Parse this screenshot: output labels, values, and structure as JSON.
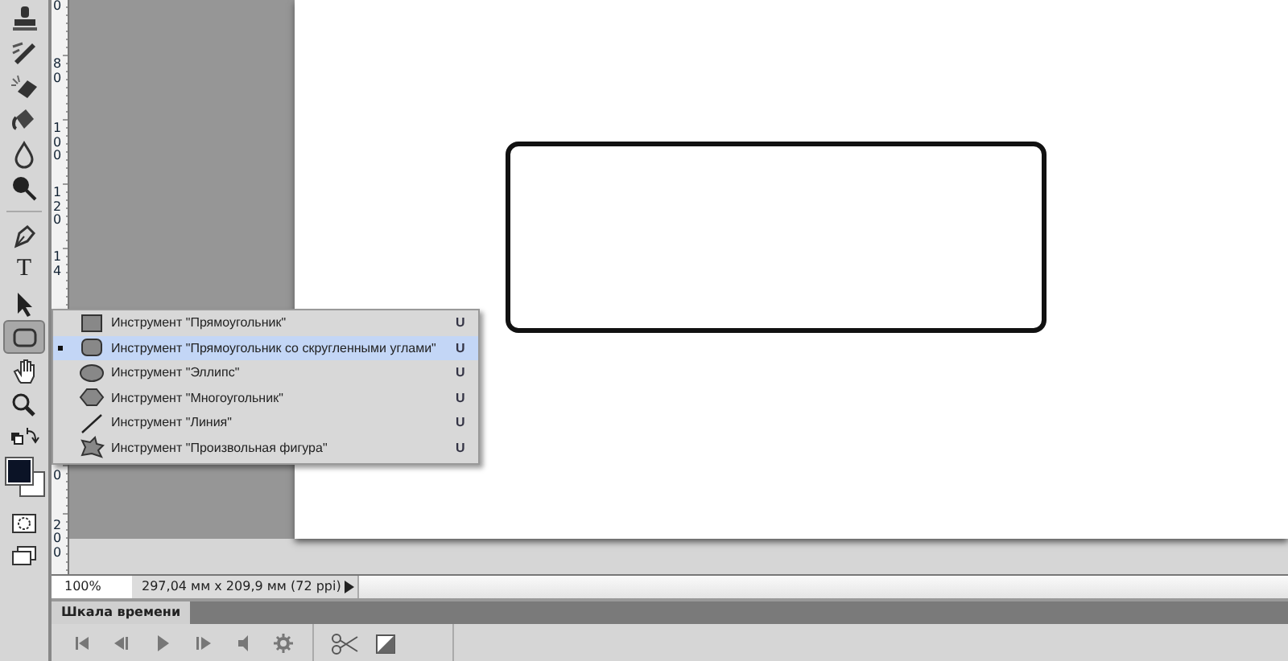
{
  "toolbar": {
    "tools": [
      {
        "kind": "stamp",
        "selected": false
      },
      {
        "kind": "history-brush",
        "selected": false
      },
      {
        "kind": "eraser",
        "selected": false
      },
      {
        "kind": "bucket",
        "selected": false
      },
      {
        "kind": "blur",
        "selected": false
      },
      {
        "kind": "dodge",
        "selected": false
      },
      {
        "kind": "divider"
      },
      {
        "kind": "pen",
        "selected": false
      },
      {
        "kind": "type",
        "selected": false,
        "label": "T"
      },
      {
        "kind": "select",
        "selected": false
      },
      {
        "kind": "shape",
        "selected": true
      },
      {
        "kind": "hand",
        "selected": false
      },
      {
        "kind": "zoom",
        "selected": false
      },
      {
        "kind": "swap",
        "selected": false
      },
      {
        "kind": "colors"
      },
      {
        "kind": "mask",
        "selected": false
      },
      {
        "kind": "screen",
        "selected": false
      }
    ]
  },
  "ruler": {
    "labels": [
      "0",
      "80",
      "100",
      "120",
      "14",
      "0",
      "200"
    ]
  },
  "flyout": {
    "items": [
      {
        "kind": "rectangle",
        "label": "Инструмент \"Прямоугольник\"",
        "shortcut": "U",
        "selected": false
      },
      {
        "kind": "rounded",
        "label": "Инструмент \"Прямоугольник со скругленными углами\"",
        "shortcut": "U",
        "selected": true
      },
      {
        "kind": "ellipse",
        "label": "Инструмент \"Эллипс\"",
        "shortcut": "U",
        "selected": false
      },
      {
        "kind": "polygon",
        "label": "Инструмент \"Многоугольник\"",
        "shortcut": "U",
        "selected": false
      },
      {
        "kind": "line",
        "label": "Инструмент \"Линия\"",
        "shortcut": "U",
        "selected": false
      },
      {
        "kind": "custom",
        "label": "Инструмент \"Произвольная фигура\"",
        "shortcut": "U",
        "selected": false
      }
    ]
  },
  "status_bar": {
    "zoom": "100%",
    "info": "297,04 мм x 209,9 мм (72 ppi)"
  },
  "timeline": {
    "tab": "Шкала времени",
    "controls": [
      {
        "kind": "first"
      },
      {
        "kind": "prev"
      },
      {
        "kind": "play"
      },
      {
        "kind": "next"
      },
      {
        "kind": "audio"
      },
      {
        "kind": "settings"
      },
      {
        "kind": "divider"
      },
      {
        "kind": "split"
      },
      {
        "kind": "transition"
      },
      {
        "kind": "divider"
      }
    ]
  }
}
